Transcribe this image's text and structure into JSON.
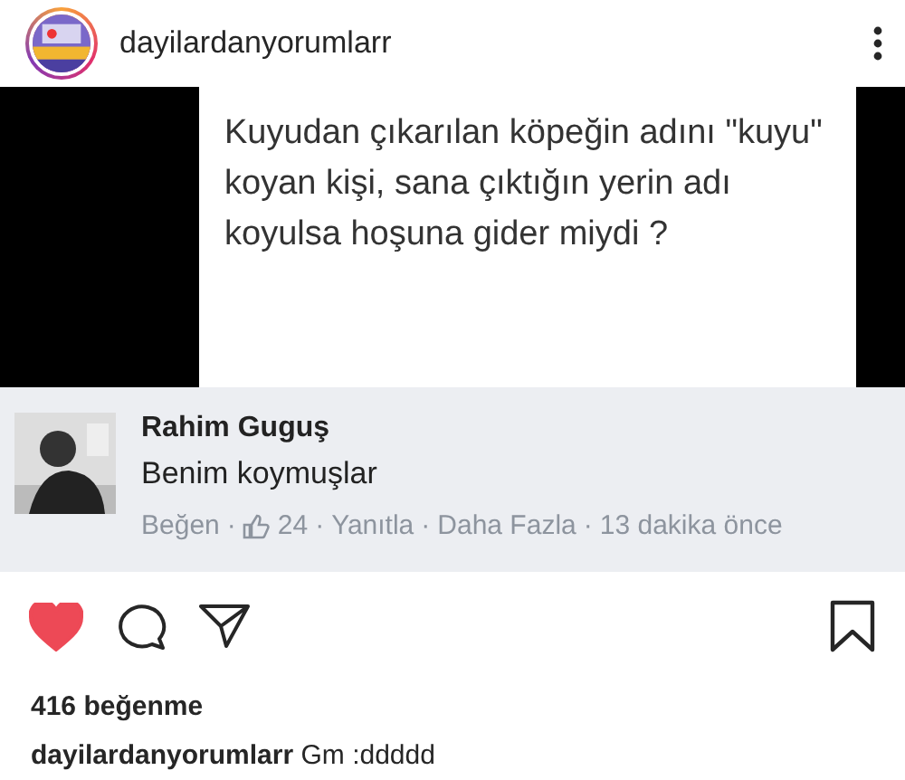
{
  "post": {
    "username": "dayilardanyorumlarr"
  },
  "image": {
    "quote": "Kuyudan çıkarılan köpeğin adını \"kuyu\" koyan kişi, sana çıktığın yerin adı koyulsa hoşuna gider miydi ?",
    "comment": {
      "author": "Rahim Guguş",
      "text": "Benim koymuşlar",
      "actions": [
        "Beğen",
        "·",
        "24",
        "·",
        "Yanıtla",
        "·",
        "Daha Fazla",
        "·",
        "13 dakika önce"
      ]
    }
  },
  "actions": {
    "liked": true
  },
  "likes": "416 beğenme",
  "caption": {
    "username": "dayilardanyorumlarr",
    "text": "Gm :ddddd"
  }
}
